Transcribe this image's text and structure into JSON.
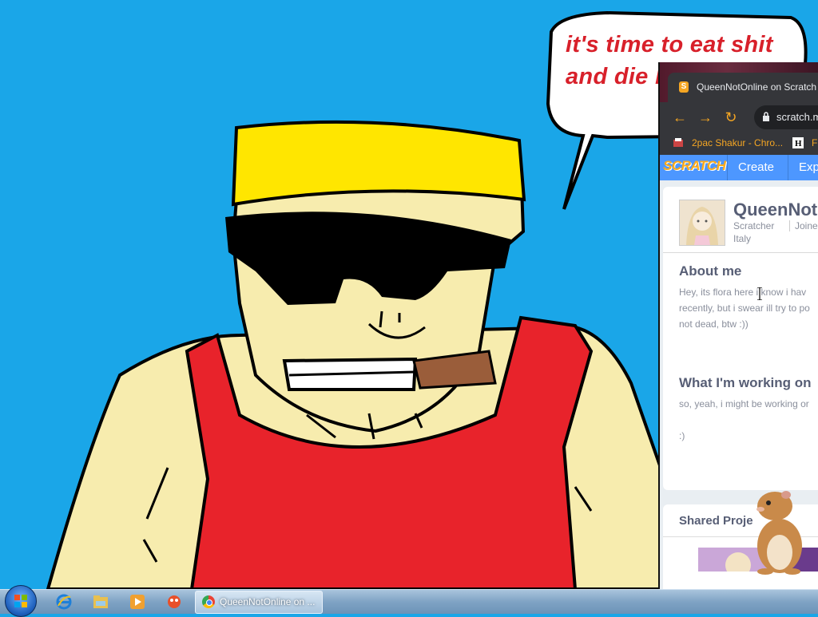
{
  "wallpaper": {
    "speech_bubble_text": "it's time to eat shit and die bubble g"
  },
  "browser": {
    "tab_title": "QueenNotOnline on Scratch",
    "url": "scratch.m",
    "bookmarks": [
      {
        "label": "2pac Shakur - Chro..."
      },
      {
        "label": "FU"
      }
    ]
  },
  "scratch": {
    "logo": "SCRATCH",
    "nav": [
      "Create",
      "Exp"
    ],
    "profile": {
      "username": "QueenNotC",
      "role": "Scratcher",
      "joined": "Joined",
      "country": "Italy"
    },
    "about": {
      "heading": "About me",
      "text": "Hey, its flora here i know i hav\nrecently, but i swear ill try to po\nnot dead, btw :))"
    },
    "working": {
      "heading": "What I'm working on",
      "text": "so, yeah, i might be working or\n\n:)"
    },
    "shared": {
      "heading": "Shared Proje"
    }
  },
  "taskbar": {
    "chrome_label": "QueenNotOnline on ..."
  },
  "colors": {
    "desktop_bg": "#1aa6e8",
    "scratch_blue": "#4d97ff",
    "chrome_orange": "#f5a623",
    "bubble_red": "#d8202a"
  }
}
